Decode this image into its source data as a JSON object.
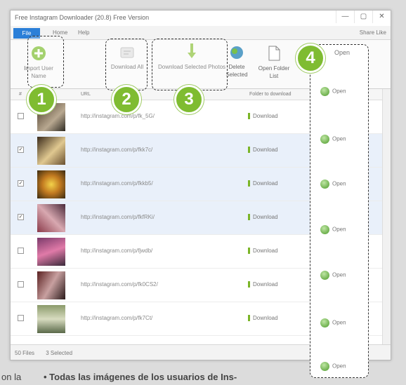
{
  "window": {
    "title": "Free Instagram Downloader (20.8) Free Version",
    "controls": [
      "—",
      "▢",
      "✕"
    ]
  },
  "menu": {
    "file": "File",
    "items": [
      "Home",
      "Help"
    ],
    "right": "Share  Like"
  },
  "ribbon": {
    "import_label": "Import User Name",
    "download_all_label": "Download All",
    "download_selected_label": "Download Selected Photos",
    "delete_label": "Delete Selected",
    "open_label": "Open Folder List"
  },
  "table": {
    "headers": [
      "#",
      "URL",
      "Folder to download"
    ],
    "rows": [
      {
        "checked": false,
        "url": "http://instagram.com/p/fk_5G/",
        "action": "Download"
      },
      {
        "checked": true,
        "url": "http://instagram.com/p/fkk7c/",
        "action": "Download"
      },
      {
        "checked": true,
        "url": "http://instagram.com/p/fkkb5/",
        "action": "Download"
      },
      {
        "checked": true,
        "url": "http://instagram.com/p/fkfRKi/",
        "action": "Download"
      },
      {
        "checked": false,
        "url": "http://instagram.com/p/fjwdb/",
        "action": "Download"
      },
      {
        "checked": false,
        "url": "http://instagram.com/p/fk0CS2/",
        "action": "Download"
      },
      {
        "checked": false,
        "url": "http://instagram.com/p/fk7Ct/",
        "action": "Download"
      }
    ]
  },
  "status": {
    "left": "50 Files",
    "right": "3 Selected"
  },
  "open_column": {
    "header": "Open",
    "items": [
      "Open",
      "Open",
      "Open",
      "Open",
      "Open",
      "Open",
      "Open"
    ]
  },
  "badges": [
    "1",
    "2",
    "3",
    "4"
  ],
  "caption": {
    "left": "on la",
    "right": "• Todas las imágenes de los usuarios de Ins-"
  },
  "colors": {
    "badge": "#7fbc31",
    "file_menu": "#2b7fd8",
    "download_mark": "#7bb528"
  }
}
